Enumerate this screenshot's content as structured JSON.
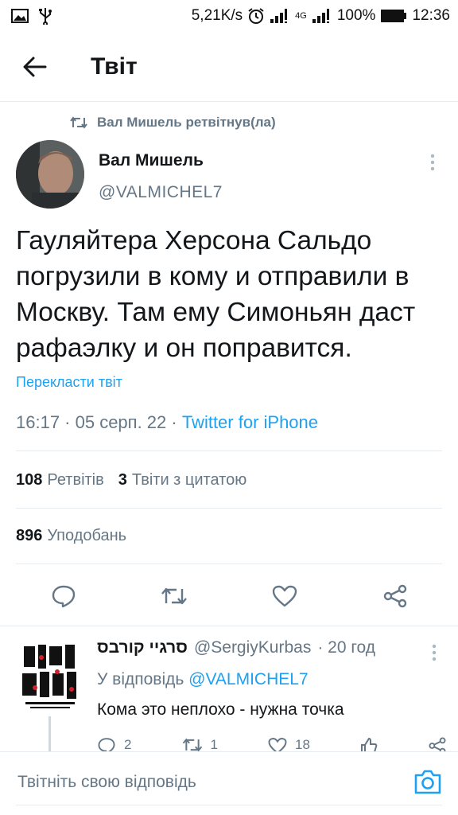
{
  "status_bar": {
    "network_speed": "5,21K/s",
    "network_type": "4G",
    "battery": "100%",
    "time": "12:36"
  },
  "header": {
    "title": "Твіт"
  },
  "retweet": {
    "text": "Вал Мишель ретвітнув(ла)"
  },
  "tweet": {
    "author_name": "Вал Мишель",
    "author_handle": "@VALMICHEL7",
    "text": "Гауляйтера Херсона Сальдо погрузили в кому и отправили в Москву. Там ему Симоньян даст рафаэлку и он поправится.",
    "translate_link": "Перекласти твіт",
    "time_date": "16:17 · 05 серп. 22 · ",
    "source": "Twitter for iPhone",
    "retweets_count": "108",
    "retweets_label": "Ретвітів",
    "quotes_count": "3",
    "quotes_label": "Твіти з цитатою",
    "likes_count": "896",
    "likes_label": "Уподобань"
  },
  "reply": {
    "author_name": "סרגיי קורבס",
    "author_handle": "@SergiyKurbas",
    "time": "· 20 год",
    "reply_to_prefix": "У відповідь ",
    "reply_to_mention": "@VALMICHEL7",
    "text": "Кома это неплохо - нужна точка",
    "replies": "2",
    "retweets": "1",
    "likes": "18"
  },
  "compose": {
    "placeholder": "Твітніть свою відповідь"
  },
  "colors": {
    "accent": "#1da1f2",
    "secondary_text": "#657786",
    "text": "#14171a"
  }
}
